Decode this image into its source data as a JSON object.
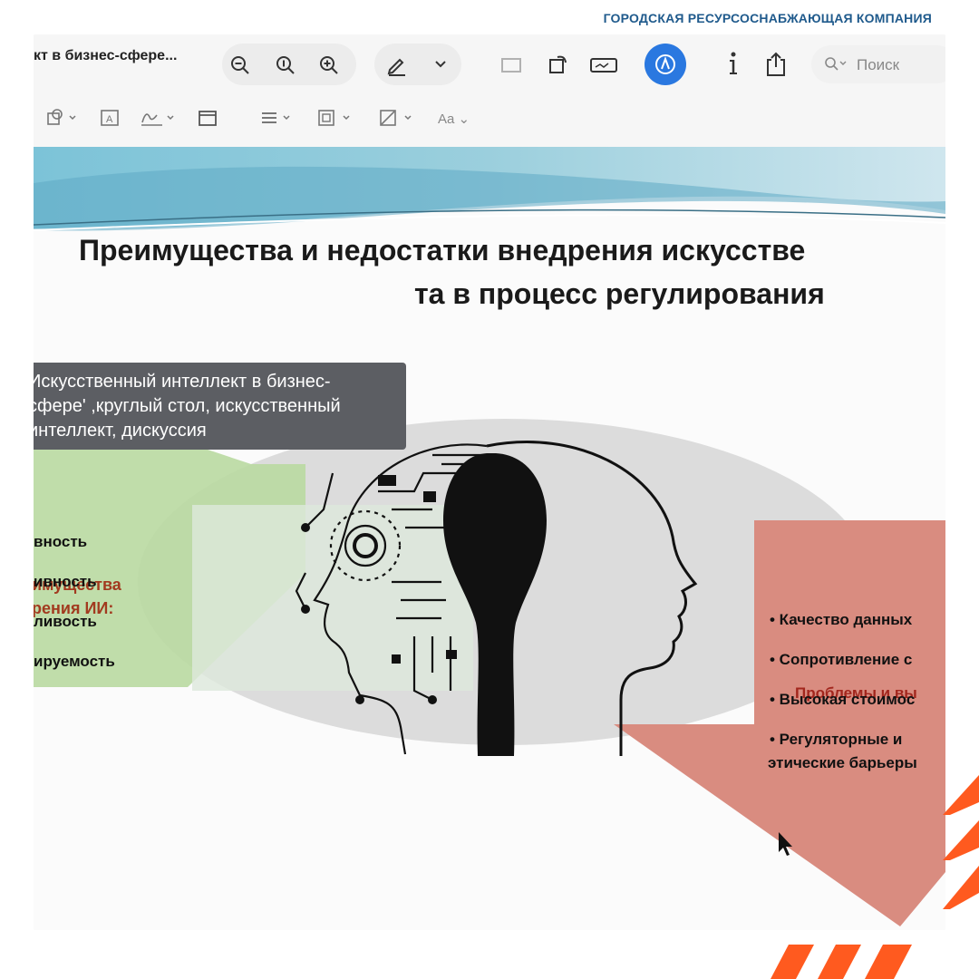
{
  "corp_name": "ГОРОДСКАЯ РЕСУРСОСНАБЖАЮЩАЯ КОМПАНИЯ",
  "toolbar": {
    "doc_title": "кт в бизнес-сфере...",
    "search_placeholder": "Поиск",
    "font_button": "Aa",
    "accent_color": "#2a78e0"
  },
  "tooltip": {
    "lines": [
      "Искусственный интеллект в бизнес-",
      "сфере' ,круглый стол, искусственный",
      "интеллект, дискуссия"
    ]
  },
  "slide": {
    "title_line1": "Преимущества и недостатки внедрения искусстве",
    "title_line2": "та в процесс регулирования",
    "advantages": {
      "title_line1": "имущества",
      "title_line2": "рения ИИ:",
      "items": [
        "вность",
        "ивность",
        "ливость",
        "ируемость"
      ]
    },
    "problems": {
      "title": "Проблемы и вы",
      "items": [
        "• Качество данных",
        "• Сопротивление с",
        "• Высокая стоимос",
        "• Регуляторные и",
        "этические барьеры"
      ]
    }
  }
}
